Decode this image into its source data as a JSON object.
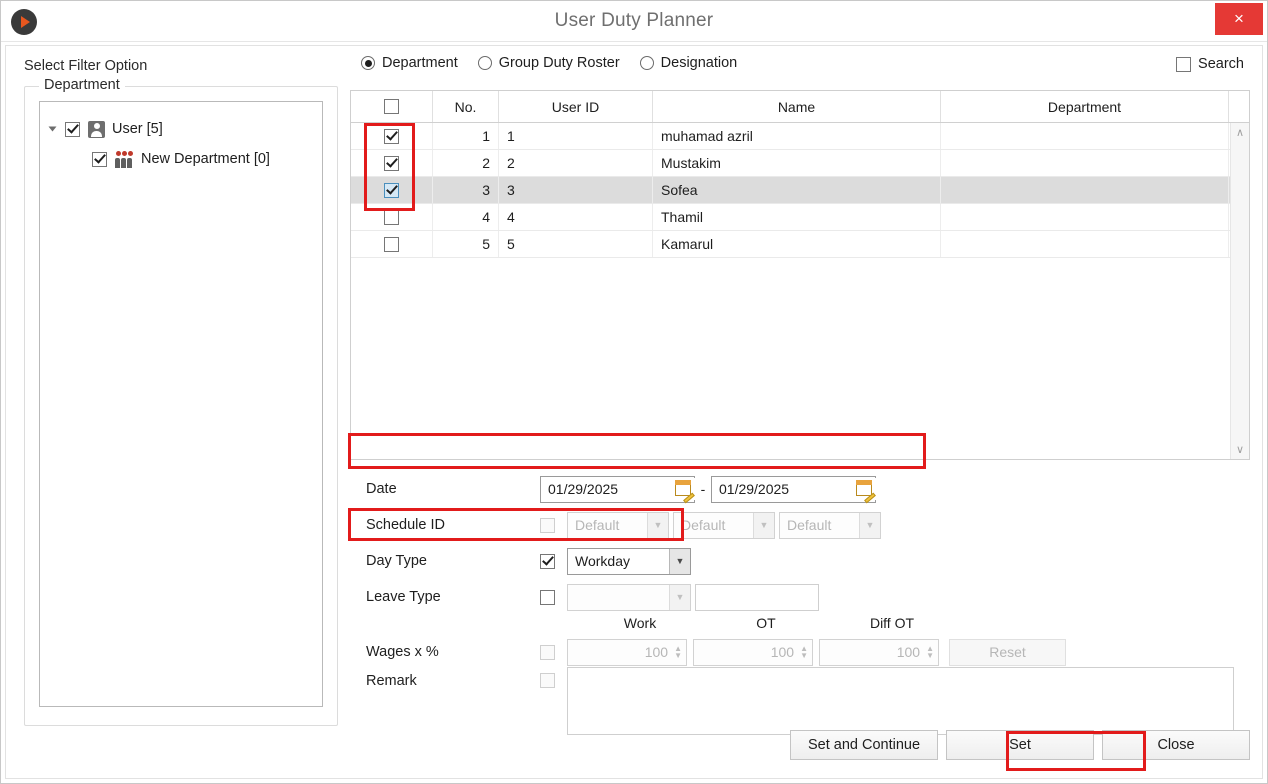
{
  "window": {
    "title": "User Duty Planner",
    "logo_icon": "play-circle-icon",
    "close_label": "×"
  },
  "filter": {
    "section_label": "Select Filter Option",
    "options": [
      {
        "label": "Department",
        "selected": true
      },
      {
        "label": "Group Duty Roster",
        "selected": false
      },
      {
        "label": "Designation",
        "selected": false
      }
    ],
    "search_label": "Search",
    "search_checked": false
  },
  "department_panel": {
    "legend": "Department",
    "tree": [
      {
        "label": "User [5]",
        "checked": true,
        "icon": "user-icon",
        "expanded": true,
        "level": 0
      },
      {
        "label": "New Department [0]",
        "checked": true,
        "icon": "group-icon",
        "level": 1
      }
    ]
  },
  "grid": {
    "columns": [
      "",
      "No.",
      "User ID",
      "Name",
      "Department"
    ],
    "rows": [
      {
        "checked": true,
        "no": "1",
        "user_id": "1",
        "name": "muhamad azril",
        "department": "",
        "selected": false
      },
      {
        "checked": true,
        "no": "2",
        "user_id": "2",
        "name": "Mustakim",
        "department": "",
        "selected": false
      },
      {
        "checked": true,
        "no": "3",
        "user_id": "3",
        "name": "Sofea",
        "department": "",
        "selected": true
      },
      {
        "checked": false,
        "no": "4",
        "user_id": "4",
        "name": "Thamil",
        "department": "",
        "selected": false
      },
      {
        "checked": false,
        "no": "5",
        "user_id": "5",
        "name": "Kamarul",
        "department": "",
        "selected": false
      }
    ],
    "scroll_up": "∧",
    "scroll_down": "∨"
  },
  "form": {
    "date": {
      "label": "Date",
      "from_value": "01/29/2025",
      "to_value": "01/29/2025",
      "separator": "-",
      "icon": "calendar-picker-icon"
    },
    "schedule_id": {
      "label": "Schedule ID",
      "checked": false,
      "values": [
        "Default",
        "Default",
        "Default"
      ]
    },
    "day_type": {
      "label": "Day Type",
      "checked": true,
      "value": "Workday"
    },
    "leave_type": {
      "label": "Leave Type",
      "checked": false,
      "value": "",
      "text_value": ""
    },
    "wages": {
      "label": "Wages x %",
      "checked": false,
      "columns": [
        "Work",
        "OT",
        "Diff OT"
      ],
      "values": [
        "100",
        "100",
        "100"
      ],
      "reset_label": "Reset"
    },
    "remark": {
      "label": "Remark",
      "checked": false,
      "value": ""
    }
  },
  "footer": {
    "set_and_continue": "Set and Continue",
    "set": "Set",
    "close": "Close"
  },
  "colors": {
    "accent_red": "#e21b1b",
    "close_red": "#e53935",
    "logo_orange": "#e8571f",
    "selected_row": "#dcdcdc"
  }
}
